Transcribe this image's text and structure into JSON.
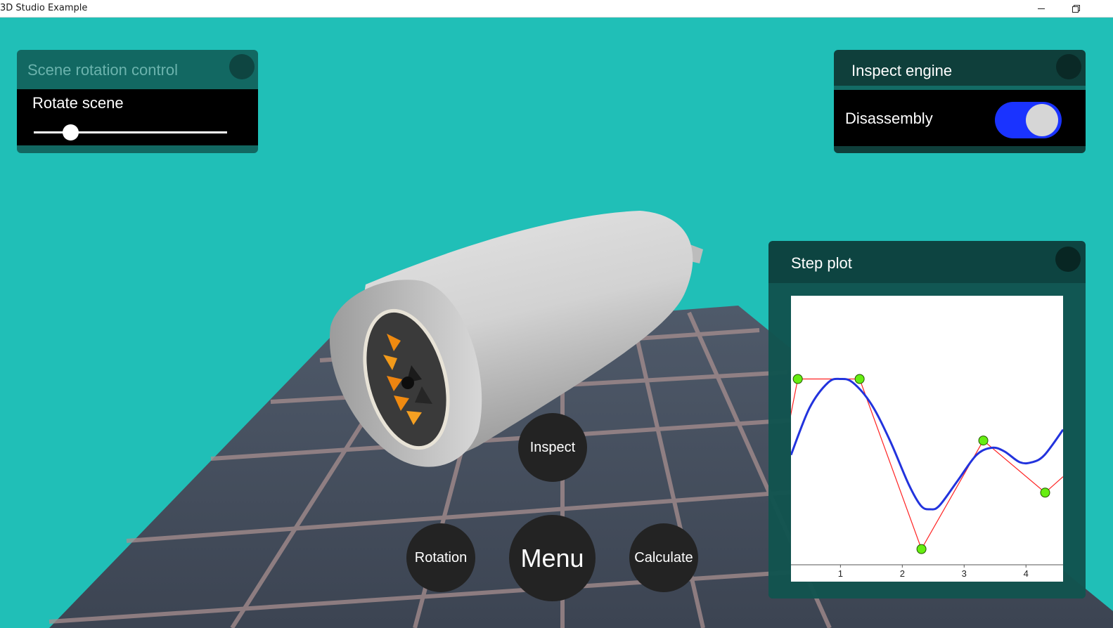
{
  "window": {
    "title": "3D Studio Example"
  },
  "rotation_panel": {
    "title": "Scene rotation control",
    "label": "Rotate scene",
    "slider_value": 0.19
  },
  "inspect_panel": {
    "title": "Inspect engine",
    "toggle_label": "Disassembly",
    "toggle_on": true
  },
  "plot_panel": {
    "title": "Step plot"
  },
  "buttons": {
    "inspect": "Inspect",
    "rotation": "Rotation",
    "menu": "Menu",
    "calculate": "Calculate"
  },
  "colors": {
    "background": "#20bfb7",
    "toggle_on": "#1a33ff",
    "curve": "#2233dd",
    "control_polygon": "#ff2222",
    "control_points": "#66ee11"
  },
  "chart_data": {
    "type": "line",
    "title": "",
    "xlabel": "",
    "ylabel": "",
    "xlim": [
      0.2,
      4.6
    ],
    "ylim": [
      -0.45,
      3.5
    ],
    "x_ticks": [
      "1",
      "2",
      "3",
      "4"
    ],
    "series": [
      {
        "kind": "control_polygon",
        "x": [
          0,
          0.31,
          1.31,
          2.31,
          3.31,
          4.31,
          4.6
        ],
        "y": [
          1.0,
          2.35,
          2.35,
          0.0,
          1.5,
          0.78,
          1.0
        ]
      },
      {
        "kind": "smooth_curve",
        "x": [
          0.2,
          0.5,
          0.8,
          1.0,
          1.2,
          1.5,
          1.8,
          2.1,
          2.3,
          2.45,
          2.6,
          2.9,
          3.2,
          3.45,
          3.65,
          3.9,
          4.1,
          4.3,
          4.6
        ],
        "y": [
          1.3,
          1.95,
          2.3,
          2.35,
          2.3,
          2.0,
          1.5,
          0.9,
          0.6,
          0.55,
          0.6,
          0.95,
          1.3,
          1.4,
          1.35,
          1.2,
          1.2,
          1.3,
          1.65
        ]
      }
    ],
    "control_points": {
      "x": [
        0.31,
        1.31,
        2.31,
        3.31,
        4.31
      ],
      "y": [
        2.35,
        2.35,
        0.0,
        1.5,
        0.78
      ]
    }
  }
}
